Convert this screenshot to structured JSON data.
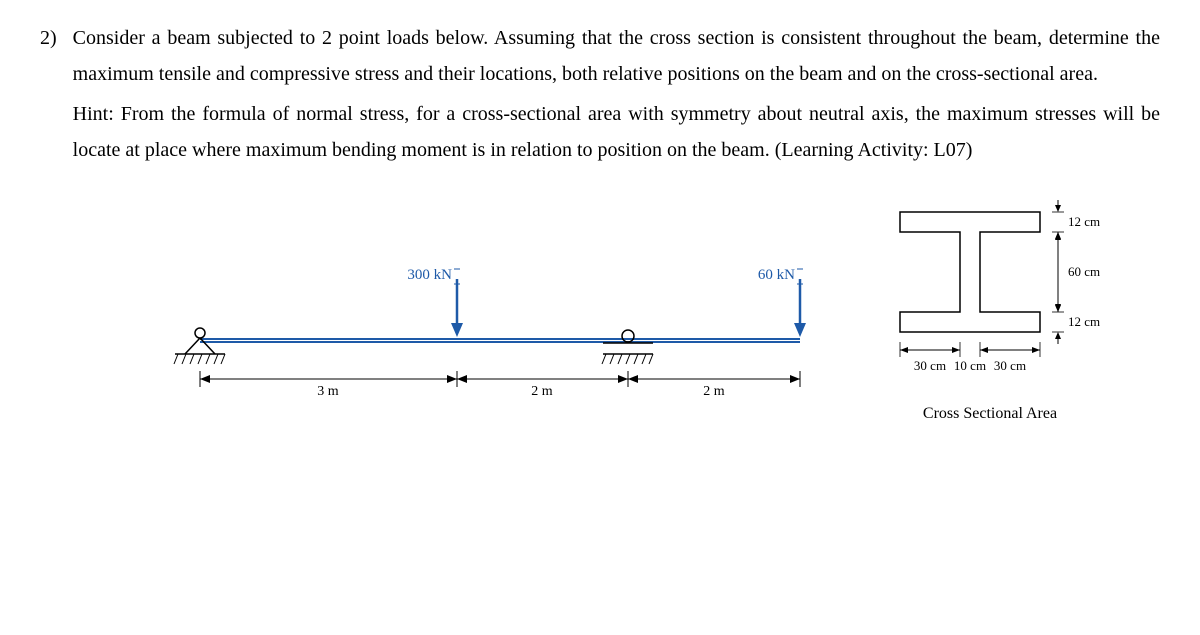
{
  "problem": {
    "number": "2)",
    "text1": "Consider a beam subjected to 2 point loads below.  Assuming that the cross section is consistent throughout the beam, determine the maximum tensile and compressive stress and their locations, both relative positions on the beam and on the cross-sectional area.",
    "text2": "Hint:  From the formula of normal stress, for a cross-sectional area with symmetry about neutral axis, the maximum stresses will be locate at place where maximum bending moment is in relation to position on the beam. (Learning Activity: L07)"
  },
  "beam": {
    "load1_label": "300 kN",
    "load2_label": "60 kN",
    "span1": "3 m",
    "span2": "2 m",
    "span3": "2 m"
  },
  "section": {
    "flange_top": "12 cm",
    "web_height": "60 cm",
    "flange_bot": "12 cm",
    "left_flange": "30 cm",
    "web_width": "10 cm",
    "right_flange": "30 cm",
    "caption": "Cross Sectional Area"
  }
}
